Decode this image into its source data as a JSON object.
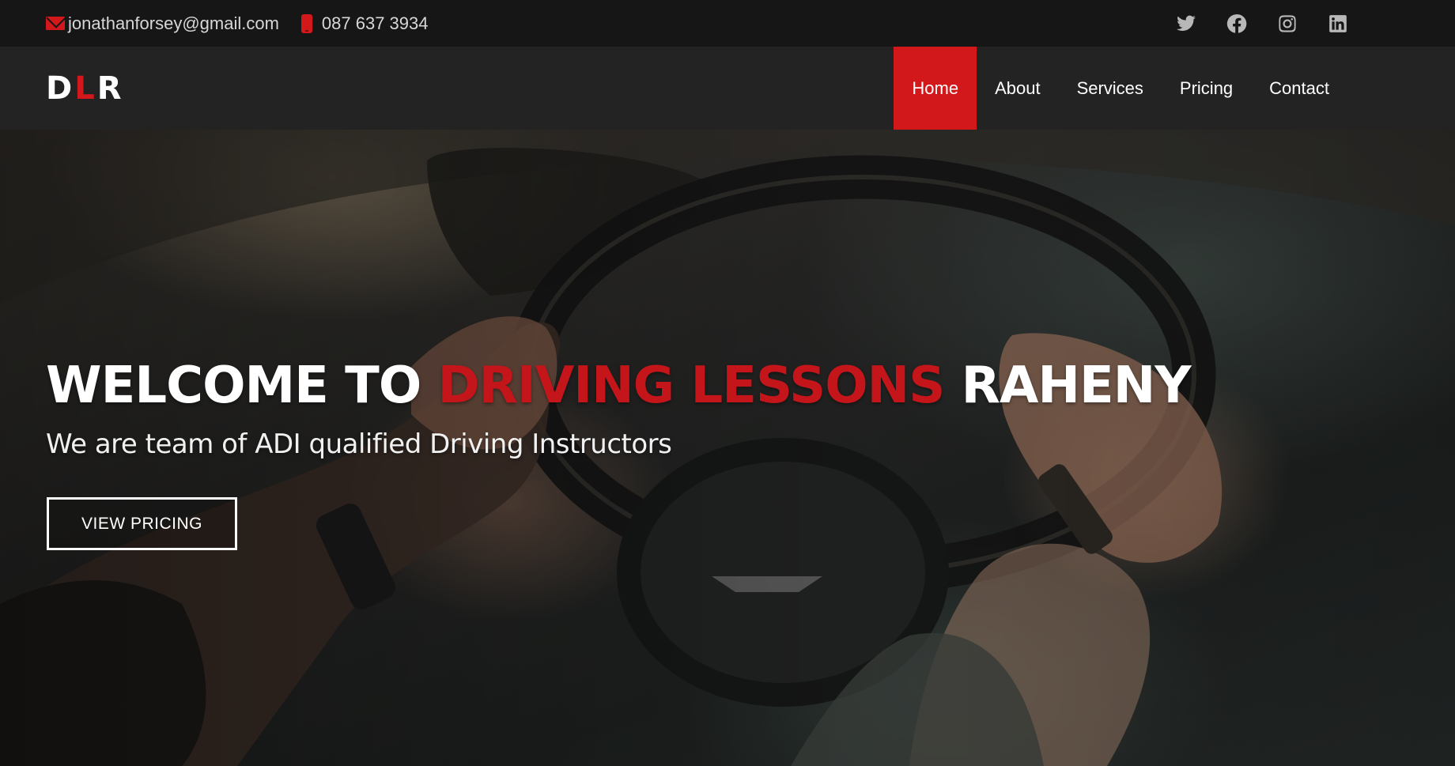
{
  "topbar": {
    "email": "jonathanforsey@gmail.com",
    "phone": "087 637 3934",
    "social": [
      "twitter-icon",
      "facebook-icon",
      "instagram-icon",
      "linkedin-icon"
    ]
  },
  "nav": {
    "logo": {
      "first": "D",
      "middle": "L",
      "last": "R"
    },
    "items": [
      {
        "label": "Home",
        "active": true
      },
      {
        "label": "About",
        "active": false
      },
      {
        "label": "Services",
        "active": false
      },
      {
        "label": "Pricing",
        "active": false
      },
      {
        "label": "Contact",
        "active": false
      }
    ]
  },
  "hero": {
    "title_start": "WELCOME TO ",
    "title_highlight": "DRIVING LESSONS",
    "title_end": " RAHENY",
    "subtitle": "We are team of ADI qualified Driving Instructors",
    "button_label": "VIEW PRICING"
  },
  "colors": {
    "accent": "#d3181b",
    "topbar_bg": "#161616",
    "nav_bg": "#232323"
  }
}
